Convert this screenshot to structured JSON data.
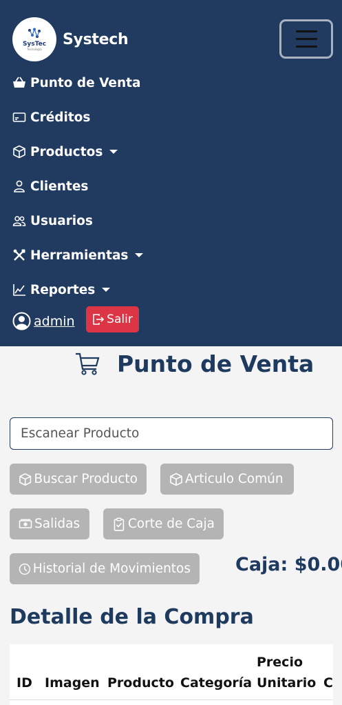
{
  "brand": {
    "name": "Systech",
    "logo_text": "SysTec",
    "logo_sub": "Tecnología"
  },
  "nav": {
    "items": [
      {
        "label": "Punto de Venta"
      },
      {
        "label": "Créditos"
      },
      {
        "label": "Productos"
      },
      {
        "label": "Clientes"
      },
      {
        "label": "Usuarios"
      },
      {
        "label": "Herramientas"
      },
      {
        "label": "Reportes"
      }
    ],
    "user": "admin",
    "logout": "Salir"
  },
  "page": {
    "title": "Punto de Venta"
  },
  "scan": {
    "placeholder": "Escanear Producto"
  },
  "buttons": {
    "buscar": "Buscar Producto",
    "articulo": "Articulo Común",
    "salidas": "Salidas",
    "corte": "Corte de Caja",
    "historial": "Historial de Movimientos"
  },
  "caja": "Caja: $0.00",
  "detalle": {
    "title": "Detalle de la Compra",
    "columns": [
      "ID",
      "Imagen",
      "Producto",
      "Categoría",
      "Precio",
      "Unitario",
      "Ca"
    ]
  },
  "colors": {
    "navbar": "#203a60",
    "accent": "#1f3a5f",
    "danger": "#dc3545",
    "button": "#b4b4b4"
  }
}
